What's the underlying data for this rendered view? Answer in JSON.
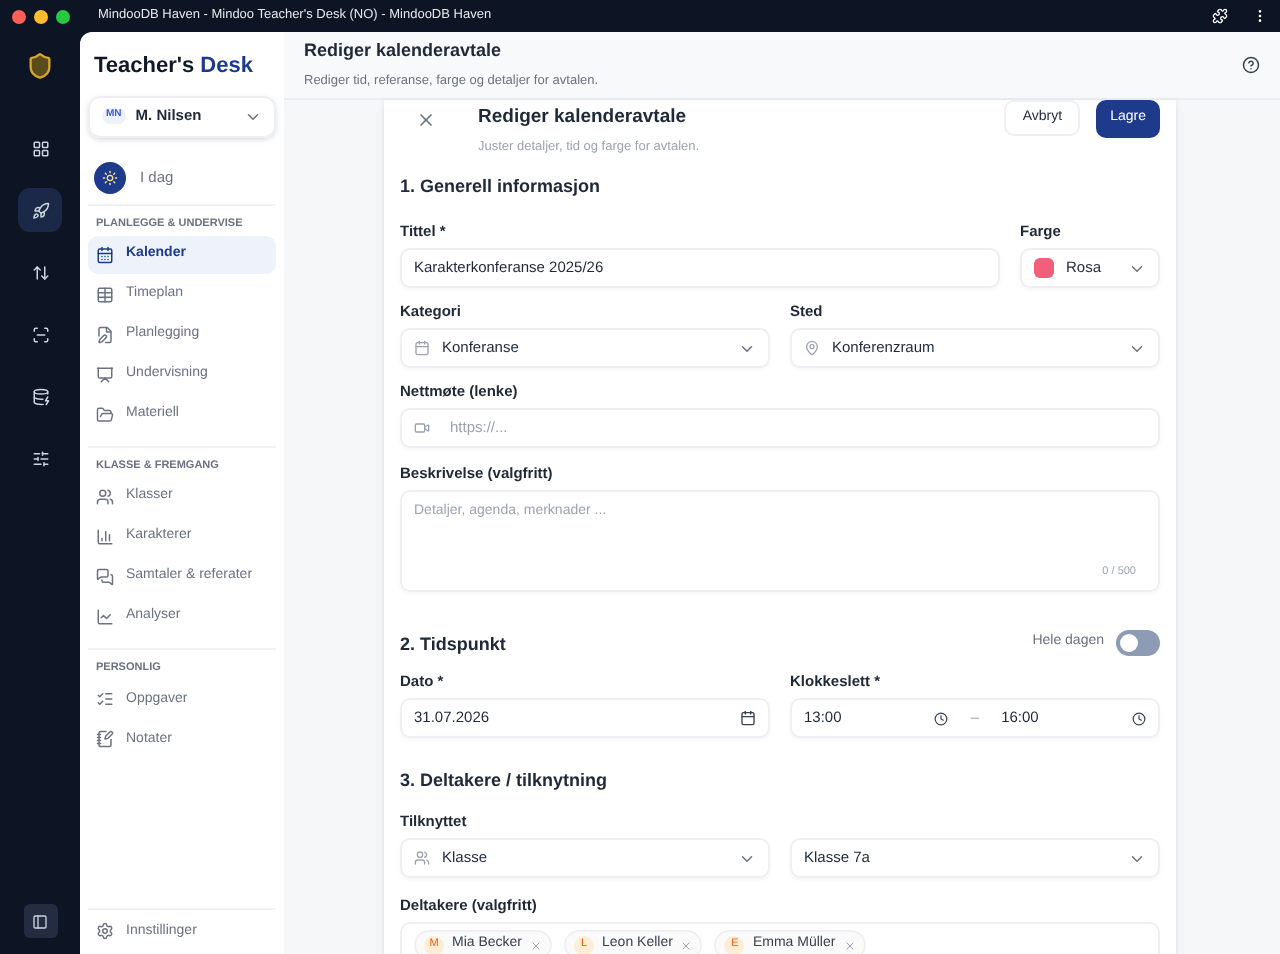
{
  "window": {
    "title": "MindooDB Haven - Mindoo Teacher's Desk (NO) - MindooDB Haven"
  },
  "rail": {
    "items": [
      {
        "selected": false
      },
      {
        "selected": true
      },
      {
        "selected": false
      },
      {
        "selected": false
      },
      {
        "selected": false
      },
      {
        "selected": false
      }
    ]
  },
  "sidebar": {
    "brand": {
      "first": "Teacher's",
      "second": "Desk"
    },
    "user": {
      "initials": "MN",
      "name": "M. Nilsen"
    },
    "today": "I dag",
    "sections": [
      {
        "title": "PLANLEGGE & UNDERVISE",
        "items": [
          {
            "label": "Kalender",
            "selected": true
          },
          {
            "label": "Timeplan",
            "selected": false
          },
          {
            "label": "Planlegging",
            "selected": false
          },
          {
            "label": "Undervisning",
            "selected": false
          },
          {
            "label": "Materiell",
            "selected": false
          }
        ]
      },
      {
        "title": "KLASSE & FREMGANG",
        "items": [
          {
            "label": "Klasser",
            "selected": false
          },
          {
            "label": "Karakterer",
            "selected": false
          },
          {
            "label": "Samtaler & referater",
            "selected": false
          },
          {
            "label": "Analyser",
            "selected": false
          }
        ]
      },
      {
        "title": "PERSONLIG",
        "items": [
          {
            "label": "Oppgaver",
            "selected": false
          },
          {
            "label": "Notater",
            "selected": false
          }
        ]
      }
    ],
    "settings": "Innstillinger"
  },
  "header": {
    "title": "Rediger kalenderavtale",
    "subtitle": "Rediger tid, referanse, farge og detaljer for avtalen."
  },
  "dialog": {
    "title": "Rediger kalenderavtale",
    "subtitle": "Juster detaljer, tid og farge for avtalen.",
    "cancel": "Avbryt",
    "save": "Lagre",
    "general": {
      "heading": "1. Generell informasjon",
      "title_label": "Tittel *",
      "title_value": "Karakterkonferanse 2025/26",
      "color_label": "Farge",
      "color_value": "Rosa",
      "color": "#f25f7a",
      "category_label": "Kategori",
      "category_value": "Konferanse",
      "place_label": "Sted",
      "place_value": "Konferenzraum",
      "meeting_label": "Nettmøte (lenke)",
      "meeting_placeholder": "https://...",
      "description_label": "Beskrivelse (valgfritt)",
      "description_placeholder": "Detaljer, agenda, merknader ...",
      "counter": "0 / 500"
    },
    "time": {
      "heading": "2. Tidspunkt",
      "all_day_label": "Hele dagen",
      "all_day": false,
      "date_label": "Dato *",
      "date_value": "31.07.2026",
      "clock_label": "Klokkeslett *",
      "start": "13:00",
      "separator": "–",
      "end": "16:00"
    },
    "participants": {
      "heading": "3. Deltakere / tilknytning",
      "linked_label": "Tilknyttet",
      "linked_type": "Klasse",
      "linked_value": "Klasse 7a",
      "list_label": "Deltakere (valgfritt)",
      "chips": [
        {
          "initial": "M",
          "name": "Mia Becker"
        },
        {
          "initial": "L",
          "name": "Leon Keller"
        },
        {
          "initial": "E",
          "name": "Emma Müller"
        }
      ]
    }
  }
}
